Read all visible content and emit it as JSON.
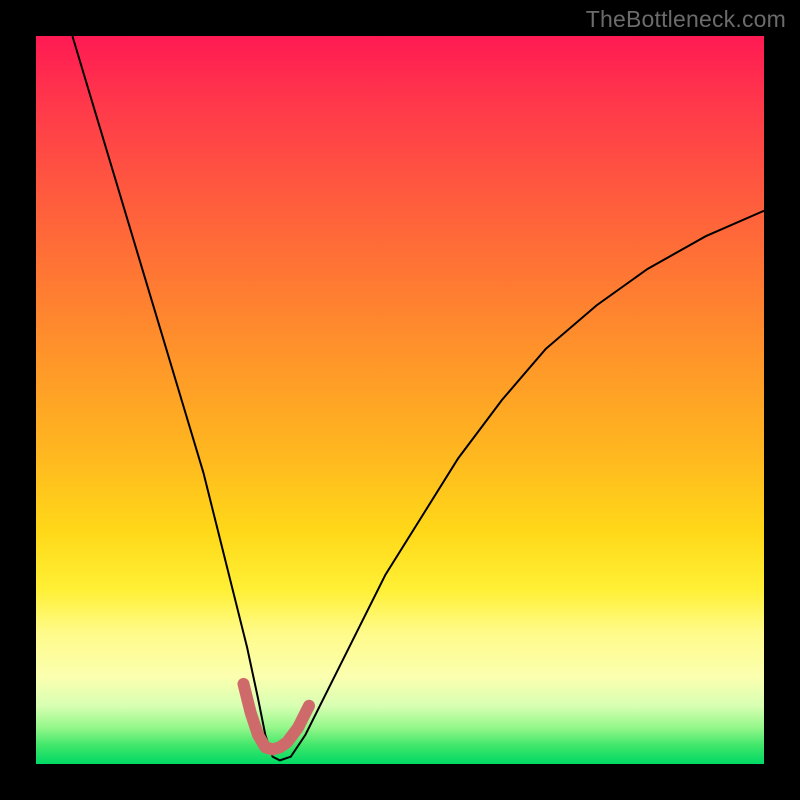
{
  "watermark": "TheBottleneck.com",
  "chart_data": {
    "type": "line",
    "title": "",
    "xlabel": "",
    "ylabel": "",
    "xlim": [
      0,
      100
    ],
    "ylim": [
      0,
      100
    ],
    "grid": false,
    "legend": false,
    "annotations": [],
    "series": [
      {
        "name": "bottleneck-curve",
        "stroke": "#000000",
        "stroke_width": 2,
        "x": [
          5,
          8,
          11,
          14,
          17,
          20,
          23,
          25,
          27,
          29,
          30.5,
          31.5,
          32.5,
          33.5,
          35,
          37,
          40,
          44,
          48,
          53,
          58,
          64,
          70,
          77,
          84,
          92,
          100
        ],
        "y": [
          100,
          90,
          80,
          70,
          60,
          50,
          40,
          32,
          24,
          16,
          9,
          4,
          1,
          0.5,
          1,
          4,
          10,
          18,
          26,
          34,
          42,
          50,
          57,
          63,
          68,
          72.5,
          76
        ]
      },
      {
        "name": "sweet-spot-marker",
        "stroke": "#cf6a6a",
        "stroke_width": 12,
        "linecap": "round",
        "x": [
          28.5,
          29.5,
          30.5,
          31.5,
          32.5,
          33.5,
          34.5,
          36,
          37.5
        ],
        "y": [
          11,
          7,
          4,
          2.3,
          2,
          2.3,
          3,
          5,
          8
        ]
      }
    ],
    "background_gradient": {
      "direction": "top-to-bottom",
      "stops": [
        {
          "pos": 0,
          "color": "#ff1a53"
        },
        {
          "pos": 0.46,
          "color": "#ff9a28"
        },
        {
          "pos": 0.76,
          "color": "#fff035"
        },
        {
          "pos": 0.95,
          "color": "#94f78a"
        },
        {
          "pos": 1,
          "color": "#00d964"
        }
      ]
    }
  }
}
